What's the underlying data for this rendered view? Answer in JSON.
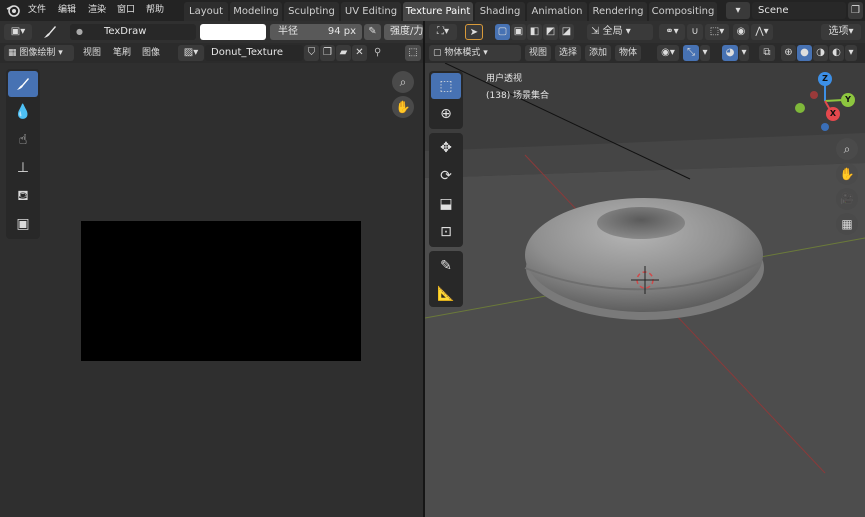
{
  "topbar": {
    "menus": [
      "文件",
      "编辑",
      "渲染",
      "窗口",
      "帮助"
    ],
    "workspaces": [
      "Layout",
      "Modeling",
      "Sculpting",
      "UV Editing",
      "Texture Paint",
      "Shading",
      "Animation",
      "Rendering",
      "Compositing"
    ],
    "active_workspace": "Texture Paint",
    "scene_name": "Scene"
  },
  "image_editor": {
    "brush_name": "TexDraw",
    "radius_label": "半径",
    "radius_value": "94 px",
    "strength_label": "强度/力",
    "mode_label": "图像绘制",
    "menus": [
      "视图",
      "笔刷",
      "图像"
    ],
    "image_name": "Donut_Texture"
  },
  "viewport": {
    "mode_label": "物体模式",
    "menus": [
      "视图",
      "选择",
      "添加",
      "物体"
    ],
    "orientation_label": "全局",
    "options_label": "选项",
    "view_title": "用户透视",
    "collection_label": "(138) 场景集合"
  },
  "gizmo": {
    "x": "X",
    "y": "Y",
    "z": "Z"
  },
  "colors": {
    "active_tab": "#474747",
    "accent_blue": "#4772b3",
    "axis_x": "#e5484d",
    "axis_y": "#8dc63f",
    "axis_z": "#3d8fe6"
  }
}
